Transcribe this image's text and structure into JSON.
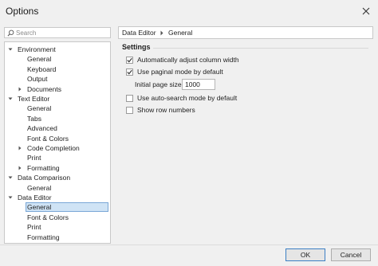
{
  "window": {
    "title": "Options"
  },
  "search": {
    "placeholder": "Search",
    "value": ""
  },
  "tree": [
    {
      "label": "Environment",
      "level": 0,
      "expander": "expanded"
    },
    {
      "label": "General",
      "level": 1,
      "expander": "none"
    },
    {
      "label": "Keyboard",
      "level": 1,
      "expander": "none"
    },
    {
      "label": "Output",
      "level": 1,
      "expander": "none"
    },
    {
      "label": "Documents",
      "level": 1,
      "expander": "collapsed"
    },
    {
      "label": "Text Editor",
      "level": 0,
      "expander": "expanded"
    },
    {
      "label": "General",
      "level": 1,
      "expander": "none"
    },
    {
      "label": "Tabs",
      "level": 1,
      "expander": "none"
    },
    {
      "label": "Advanced",
      "level": 1,
      "expander": "none"
    },
    {
      "label": "Font & Colors",
      "level": 1,
      "expander": "none"
    },
    {
      "label": "Code Completion",
      "level": 1,
      "expander": "collapsed"
    },
    {
      "label": "Print",
      "level": 1,
      "expander": "none"
    },
    {
      "label": "Formatting",
      "level": 1,
      "expander": "collapsed"
    },
    {
      "label": "Data Comparison",
      "level": 0,
      "expander": "expanded"
    },
    {
      "label": "General",
      "level": 1,
      "expander": "none"
    },
    {
      "label": "Data Editor",
      "level": 0,
      "expander": "expanded"
    },
    {
      "label": "General",
      "level": 1,
      "expander": "none",
      "selected": true
    },
    {
      "label": "Font & Colors",
      "level": 1,
      "expander": "none"
    },
    {
      "label": "Print",
      "level": 1,
      "expander": "none"
    },
    {
      "label": "Formatting",
      "level": 1,
      "expander": "none"
    }
  ],
  "breadcrumb": {
    "parent": "Data Editor",
    "current": "General"
  },
  "settings": {
    "title": "Settings",
    "options": [
      {
        "label": "Automatically adjust column width",
        "checked": true
      },
      {
        "label": "Use paginal mode by default",
        "checked": true
      },
      {
        "label": "Use auto-search mode by default",
        "checked": false
      },
      {
        "label": "Show row numbers",
        "checked": false
      }
    ],
    "page_size_label": "Initial page size:",
    "page_size_value": "1000"
  },
  "buttons": {
    "ok": "OK",
    "cancel": "Cancel"
  },
  "colors": {
    "accent": "#3c7fc4",
    "selection": "#cfe3f5"
  }
}
